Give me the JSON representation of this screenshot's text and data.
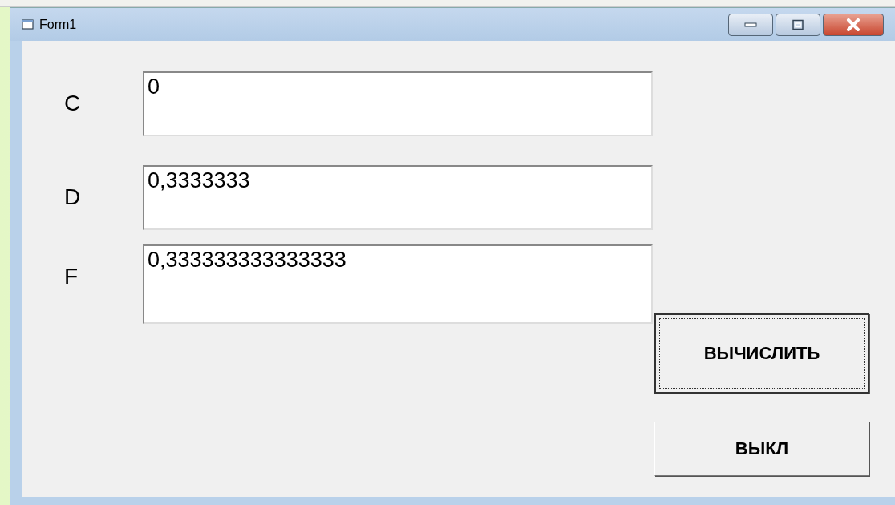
{
  "window": {
    "title": "Form1"
  },
  "fields": [
    {
      "label": "C",
      "value": "0"
    },
    {
      "label": "D",
      "value": "0,3333333"
    },
    {
      "label": "F",
      "value": "0,333333333333333"
    }
  ],
  "buttons": [
    {
      "label": "ВЫЧИСЛИТЬ",
      "default": true
    },
    {
      "label": "ВЫКЛ",
      "default": false
    }
  ]
}
